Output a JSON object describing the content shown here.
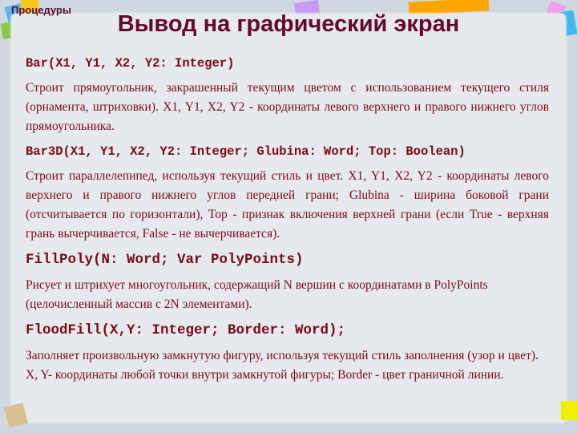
{
  "section": "Процедуры",
  "title": "Вывод на графический экран",
  "items": [
    {
      "signature": "Bar(X1, Y1, X2, Y2: Integer)",
      "description": "Строит прямоугольник, закрашенный текущим цветом с использованием текущего стиля (орнамента, штриховки). X1, Y1, X2, Y2 - координаты левого верхнего и правого нижнего углов прямоугольника."
    },
    {
      "signature": "Bar3D(X1, Y1, X2, Y2: Integer; Glubina: Word; Top: Boolean)",
      "description": "Строит параллелепипед, используя текущий стиль и цвет. X1, Y1, X2, Y2 - координаты левого верхнего и правого нижнего углов передней грани; Glubina - ширина боковой грани (отсчитывается по горизонтали), Top - признак включения верхней грани (если True - верхняя грань вычерчивается, False - не вычерчивается)."
    },
    {
      "signature": "FillPoly(N: Word; Var PolyPoints)",
      "description": "Рисует и штрихует многоугольник, содержащий N вершин с координатами в PolyPoints (целочисленный массив с 2N элементами)."
    },
    {
      "signature": "FloodFill(X,Y: Integer; Border: Word);",
      "description": "Заполняет произвольную замкнутую фигуру, используя текущий стиль заполнения (узор и цвет). X, Y- координаты любой точки внутри замкнутой фигуры; Border - цвет граничной линии."
    }
  ],
  "colors": {
    "text": "#7a0a14",
    "title": "#64082e",
    "card": "#e6e9ee",
    "background": "#cfd8e0"
  }
}
